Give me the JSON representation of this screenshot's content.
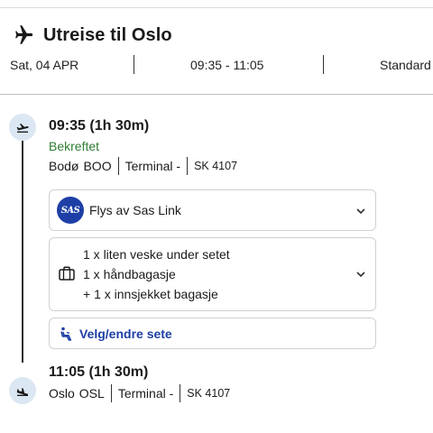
{
  "header": {
    "title": "Utreise til Oslo"
  },
  "meta": {
    "date": "Sat, 04 APR",
    "time_range": "09:35 - 11:05",
    "fare": "Standard"
  },
  "departure": {
    "time": "09:35  (1h 30m)",
    "status": "Bekreftet",
    "city": "Bodø",
    "code": "BOO",
    "terminal": "Terminal -",
    "flight": "SK 4107"
  },
  "airline": {
    "logo_text": "SAS",
    "label": "Flys av Sas Link"
  },
  "baggage": {
    "lines": [
      "1 x liten veske under setet",
      "1 x håndbagasje",
      "+ 1 x innsjekket bagasje"
    ]
  },
  "seat": {
    "label": "Velg/endre sete"
  },
  "arrival": {
    "time": "11:05  (1h 30m)",
    "city": "Oslo",
    "code": "OSL",
    "terminal": "Terminal -",
    "flight": "SK 4107"
  },
  "colors": {
    "accent": "#1d3fa6",
    "status": "#2e7d32",
    "circle": "#dbe7f2"
  },
  "icons": {
    "header": "airplane-icon",
    "depart": "takeoff-icon",
    "arrive": "landing-icon",
    "bag": "briefcase-icon",
    "seat": "seat-icon",
    "expand": "chevron-down-icon"
  }
}
